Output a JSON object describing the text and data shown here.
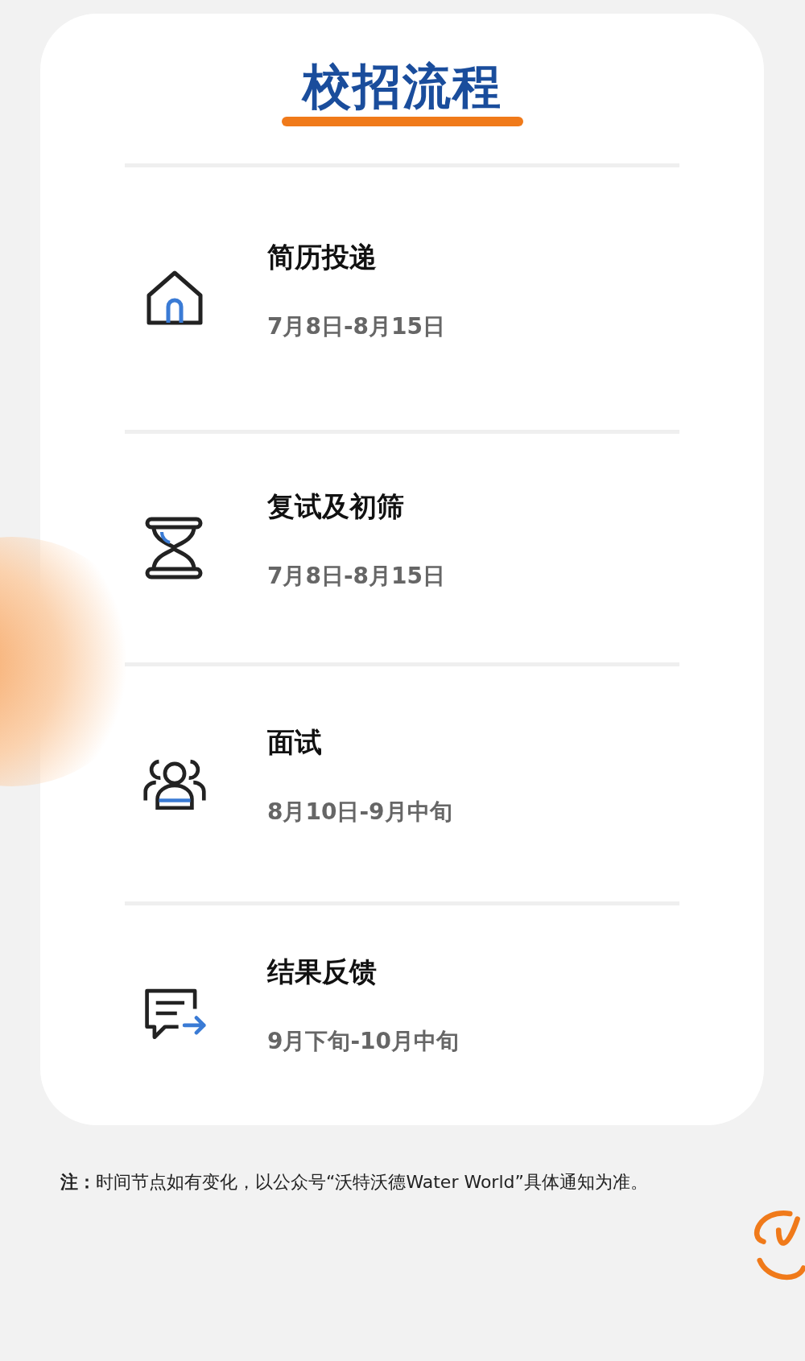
{
  "title": "校招流程",
  "steps": [
    {
      "kind": "house",
      "title": "简历投递",
      "date": "7月8日-8月15日"
    },
    {
      "kind": "hourglass",
      "title": "复试及初筛",
      "date": "7月8日-8月15日"
    },
    {
      "kind": "people",
      "title": "面试",
      "date": "8月10日-9月中旬"
    },
    {
      "kind": "message",
      "title": "结果反馈",
      "date": "9月下旬-10月中旬"
    }
  ],
  "note": "**注：**时间节点如有变化，以公众号“沃特沃德Water World”具体通知为准。"
}
